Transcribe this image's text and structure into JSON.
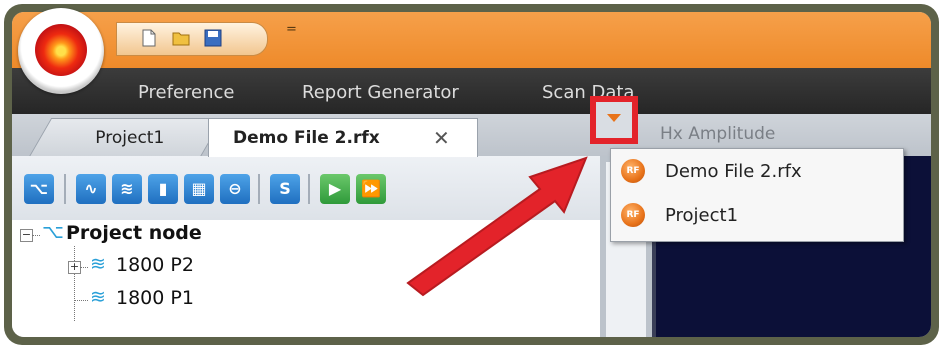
{
  "quick_access": {
    "items": [
      "new-file-icon",
      "open-folder-icon",
      "save-icon"
    ],
    "overflow_label": "="
  },
  "menu": {
    "items": [
      {
        "label": "Preference"
      },
      {
        "label": "Report Generator"
      },
      {
        "label": "Scan Data"
      }
    ]
  },
  "tabs": {
    "items": [
      {
        "label": "Project1",
        "active": false
      },
      {
        "label": "Demo File 2.rfx",
        "active": true,
        "close_glyph": "✕"
      }
    ],
    "panel_title": "Hx Amplitude"
  },
  "toolbar": {
    "icons": [
      "tree-icon",
      "wave-icon",
      "waves-icon",
      "probe-icon",
      "grid-icon",
      "globe-icon",
      "s-icon",
      "play-icon",
      "fast-forward-icon"
    ],
    "s_label": "S"
  },
  "tree": {
    "root": {
      "label": "Project node",
      "expander": "−"
    },
    "children": [
      {
        "label": "1800 P2",
        "expander": "+"
      },
      {
        "label": "1800 P1"
      }
    ]
  },
  "dropdown": {
    "badge": "RF",
    "items": [
      {
        "label": "Demo File 2.rfx"
      },
      {
        "label": "Project1"
      }
    ]
  },
  "colors": {
    "highlight": "#e3232a",
    "accent": "#ee8a2a",
    "panel": "#0c1038"
  }
}
